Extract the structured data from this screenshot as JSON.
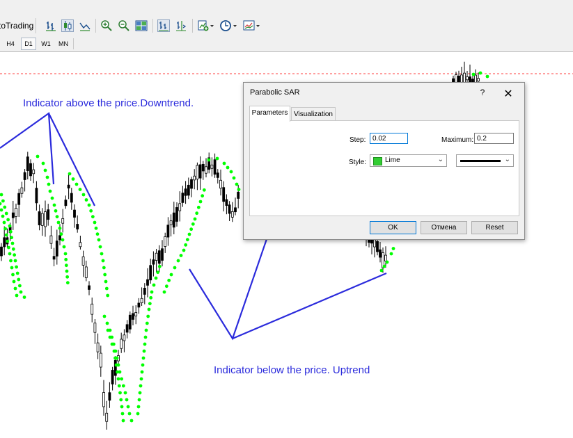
{
  "toolbar": {
    "autotrading_label": "toTrading",
    "icons": [
      "bar-chart-icon",
      "candlestick-icon",
      "line-chart-icon",
      "zoom-in-icon",
      "zoom-out-icon",
      "tile-windows-icon",
      "autoscroll-icon",
      "chart-shift-icon",
      "indicators-icon",
      "periods-icon",
      "templates-icon"
    ]
  },
  "timeframes": [
    {
      "label": "H4",
      "active": false
    },
    {
      "label": "D1",
      "active": true
    },
    {
      "label": "W1",
      "active": false
    },
    {
      "label": "MN",
      "active": false
    }
  ],
  "annotations": {
    "downtrend": "Indicator above the price.Downtrend.",
    "uptrend": "Indicator below the price. Uptrend"
  },
  "colors": {
    "sar_dots": "#00ff00",
    "annotation": "#2b2bdc",
    "candles": "#000000",
    "grid_line": "#ff0000"
  },
  "dialog": {
    "title": "Parabolic SAR",
    "help_label": "?",
    "close_label": "✕",
    "tabs": [
      {
        "label": "Parameters",
        "active": true
      },
      {
        "label": "Visualization",
        "active": false
      }
    ],
    "step_label": "Step:",
    "step_value": "0.02",
    "maximum_label": "Maximum:",
    "maximum_value": "0.2",
    "style_label": "Style:",
    "style_color_name": "Lime",
    "style_color": "#32cd32",
    "buttons": {
      "ok": "OK",
      "cancel": "Отмена",
      "reset": "Reset"
    }
  }
}
